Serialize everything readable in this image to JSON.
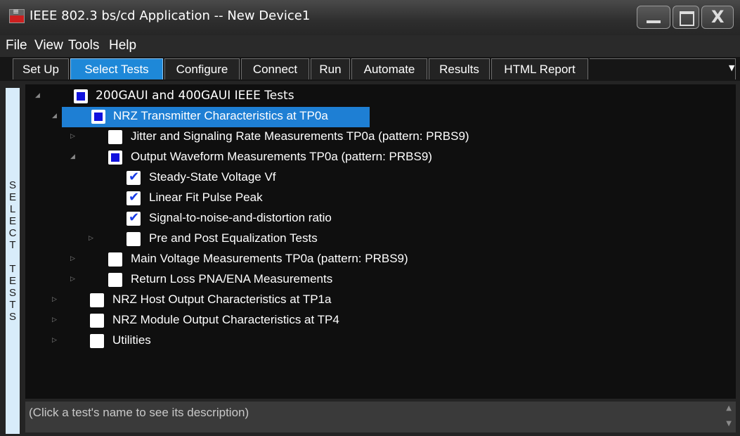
{
  "window": {
    "title": "IEEE 802.3 bs/cd Application -- New Device1"
  },
  "menu": [
    "File",
    "View",
    "Tools",
    "Help"
  ],
  "tabs": [
    {
      "label": "Set Up"
    },
    {
      "label": "Select Tests"
    },
    {
      "label": "Configure"
    },
    {
      "label": "Connect"
    },
    {
      "label": "Run"
    },
    {
      "label": "Automate"
    },
    {
      "label": "Results"
    },
    {
      "label": "HTML Report"
    }
  ],
  "side_panel": {
    "label": "SELECT TESTS"
  },
  "tree": [
    {
      "label": "200GAUI and 400GAUI IEEE Tests",
      "state": "partial",
      "expanded": true
    },
    {
      "label": "NRZ Transmitter Characteristics at TP0a",
      "state": "partial",
      "expanded": true,
      "selected": true
    },
    {
      "label": "Jitter and Signaling Rate Measurements TP0a (pattern: PRBS9)",
      "state": "unchecked",
      "expanded": false
    },
    {
      "label": "Output Waveform Measurements TP0a (pattern: PRBS9)",
      "state": "partial",
      "expanded": true
    },
    {
      "label": "Steady-State Voltage Vf",
      "state": "checked"
    },
    {
      "label": "Linear Fit Pulse Peak",
      "state": "checked"
    },
    {
      "label": "Signal-to-noise-and-distortion ratio",
      "state": "checked"
    },
    {
      "label": "Pre and Post Equalization Tests",
      "state": "unchecked",
      "expanded": false
    },
    {
      "label": "Main Voltage Measurements TP0a (pattern: PRBS9)",
      "state": "unchecked",
      "expanded": false
    },
    {
      "label": "Return Loss PNA/ENA Measurements",
      "state": "unchecked",
      "expanded": false
    },
    {
      "label": "NRZ Host Output Characteristics at TP1a",
      "state": "unchecked",
      "expanded": false
    },
    {
      "label": "NRZ Module Output Characteristics at TP4",
      "state": "unchecked",
      "expanded": false
    },
    {
      "label": "Utilities",
      "state": "unchecked",
      "expanded": false
    }
  ],
  "description": {
    "placeholder": "(Click a test's name to see its description)"
  }
}
